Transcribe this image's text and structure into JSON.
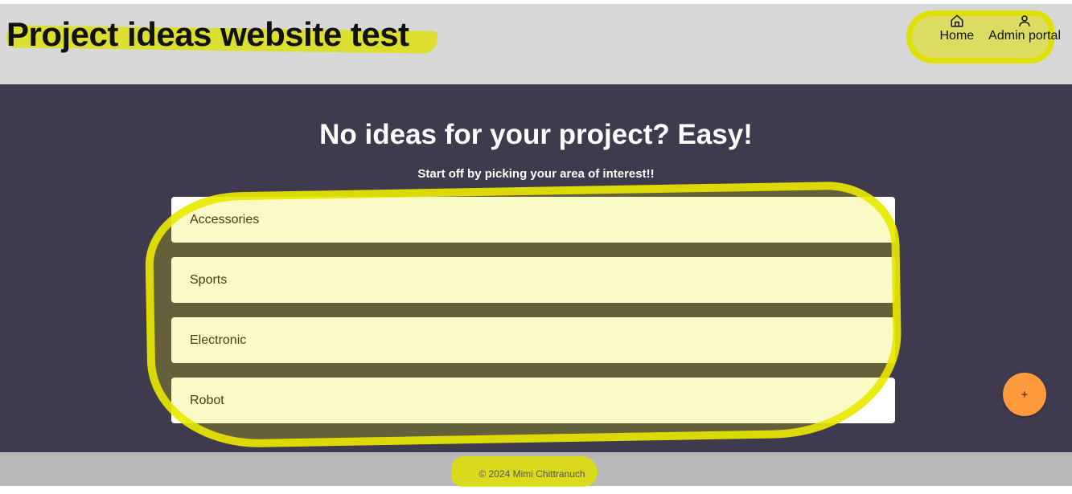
{
  "header": {
    "title": "Project ideas website test",
    "nav": [
      {
        "label": "Home",
        "icon": "home-icon"
      },
      {
        "label": "Admin portal",
        "icon": "user-icon"
      }
    ]
  },
  "main": {
    "heading": "No ideas for your project? Easy!",
    "subheading": "Start off by picking your area of interest!!",
    "categories": [
      {
        "label": "Accessories"
      },
      {
        "label": "Sports"
      },
      {
        "label": "Electronic"
      },
      {
        "label": "Robot"
      }
    ],
    "fab_label": "+"
  },
  "footer": {
    "text": "© 2024 Mimi Chittranuch"
  },
  "colors": {
    "header_bg": "#d8d8d8",
    "main_bg": "#3f3a4d",
    "fab": "#ff9a3d",
    "highlight": "#dee000",
    "footer_bg": "#b8b8b8"
  }
}
